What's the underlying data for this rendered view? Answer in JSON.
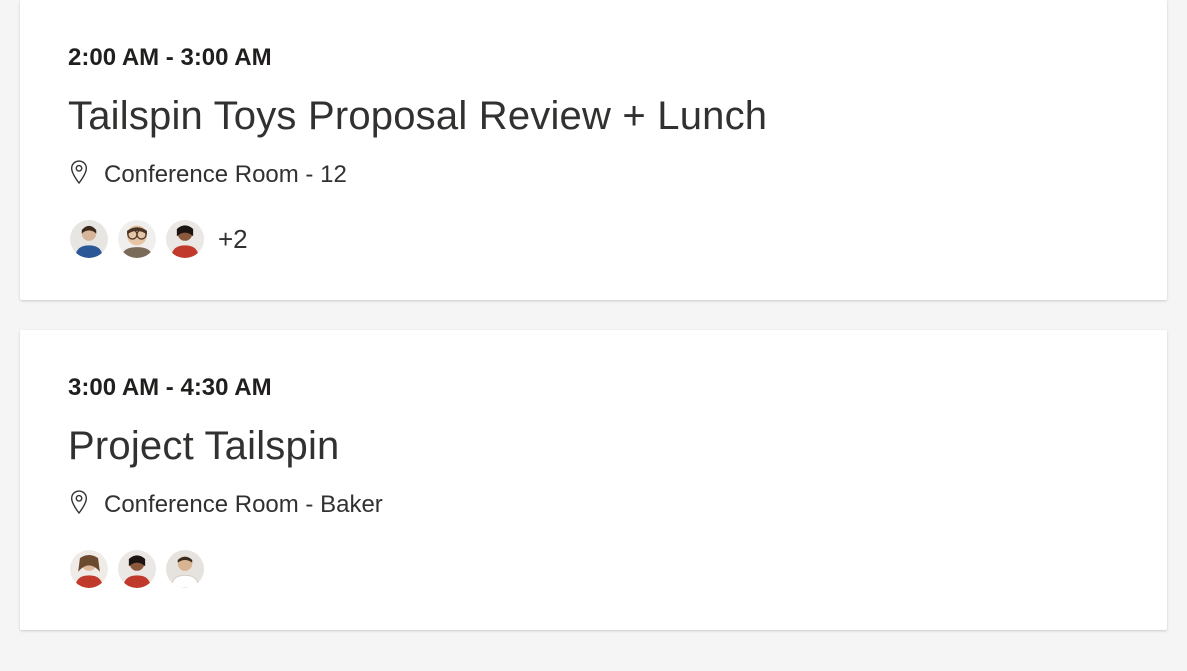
{
  "events": [
    {
      "time": "2:00 AM - 3:00 AM",
      "title": "Tailspin Toys Proposal Review + Lunch",
      "location": "Conference Room - 12",
      "attendees": {
        "avatars": [
          "person1",
          "person2",
          "person3"
        ],
        "more": "+2"
      }
    },
    {
      "time": "3:00 AM - 4:30 AM",
      "title": "Project Tailspin",
      "location": "Conference Room - Baker",
      "attendees": {
        "avatars": [
          "person4",
          "person5",
          "person6"
        ],
        "more": ""
      }
    }
  ]
}
